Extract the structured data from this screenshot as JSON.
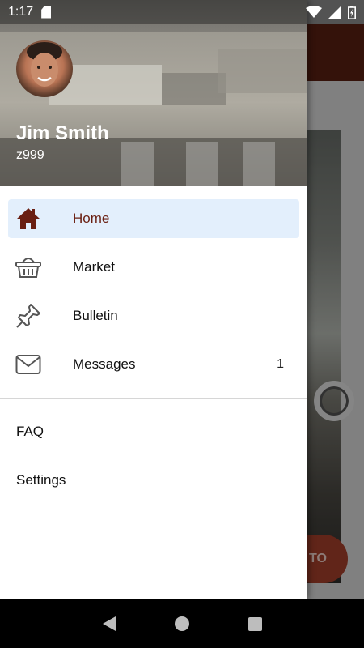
{
  "status_bar": {
    "time": "1:17"
  },
  "drawer": {
    "user": {
      "name": "Jim Smith",
      "id": "z999"
    },
    "nav_items": [
      {
        "label": "Home",
        "icon": "home-icon",
        "active": true
      },
      {
        "label": "Market",
        "icon": "basket-icon"
      },
      {
        "label": "Bulletin",
        "icon": "pushpin-icon"
      },
      {
        "label": "Messages",
        "icon": "envelope-icon",
        "badge": "1"
      }
    ],
    "secondary_items": [
      {
        "label": "FAQ"
      },
      {
        "label": "Settings"
      }
    ]
  },
  "background_app": {
    "fab_label": "TO"
  },
  "colors": {
    "accent": "#6a1f12",
    "active_bg": "#e3effc",
    "toolbar": "#5b1f12"
  }
}
